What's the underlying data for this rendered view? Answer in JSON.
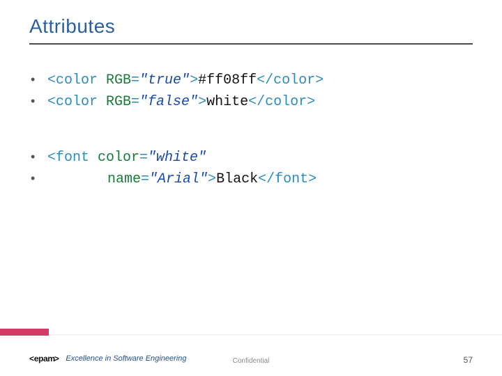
{
  "title": "Attributes",
  "lines": {
    "l1": {
      "open": "<color ",
      "attr": "RGB",
      "eq": "=",
      "val": "\"true\"",
      "closeOpen": ">",
      "text": "#ff08ff",
      "close": "</color>"
    },
    "l2": {
      "open": "<color ",
      "attr": "RGB",
      "eq": "=",
      "val": "\"false\"",
      "closeOpen": ">",
      "text": "white",
      "close": "</color>"
    },
    "l3": {
      "open": "<font ",
      "attr": "color",
      "eq": "=",
      "val": "\"white\""
    },
    "l4": {
      "attr": "name",
      "eq": "=",
      "val": "\"Arial\"",
      "closeOpen": ">",
      "text": "Black",
      "close": "</font>"
    }
  },
  "footer": {
    "logo_text": "epam",
    "tagline": "Excellence in Software Engineering",
    "confidential": "Confidential",
    "page": "57"
  }
}
